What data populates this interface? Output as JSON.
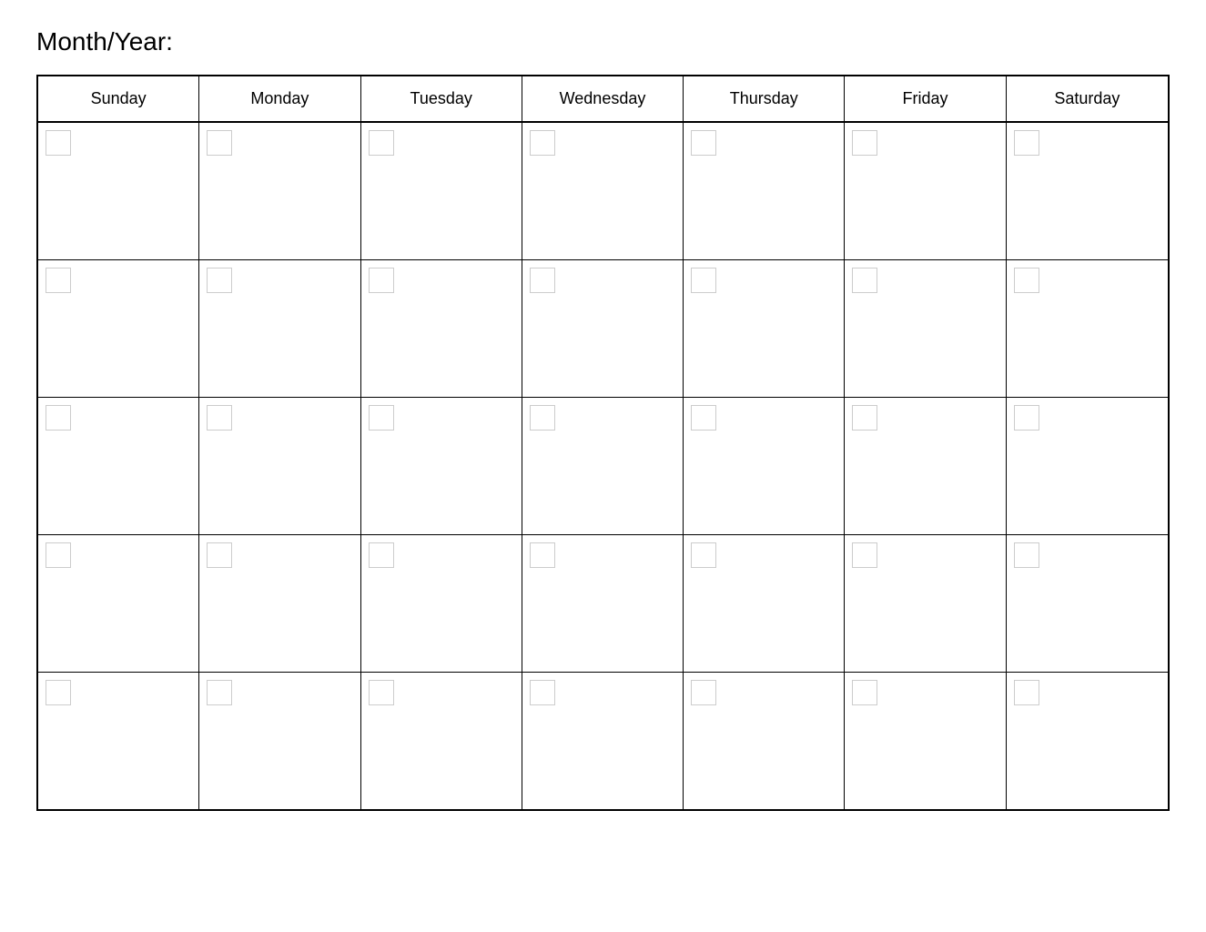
{
  "header": {
    "title": "Month/Year:"
  },
  "calendar": {
    "days": [
      {
        "label": "Sunday"
      },
      {
        "label": "Monday"
      },
      {
        "label": "Tuesday"
      },
      {
        "label": "Wednesday"
      },
      {
        "label": "Thursday"
      },
      {
        "label": "Friday"
      },
      {
        "label": "Saturday"
      }
    ],
    "rows": 5
  }
}
